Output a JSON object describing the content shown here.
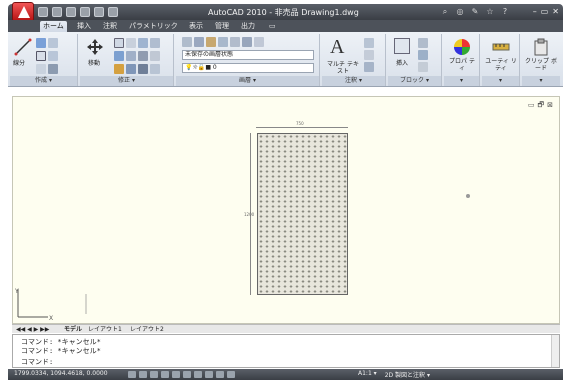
{
  "window": {
    "title": "AutoCAD 2010 - 非売品    Drawing1.dwg"
  },
  "ribbon": {
    "tabs": [
      "ホーム",
      "挿入",
      "注釈",
      "パラメトリック",
      "表示",
      "管理",
      "出力"
    ],
    "active_tab": "ホーム",
    "panels": {
      "draw": {
        "label": "作成 ▾",
        "line_label": "線分"
      },
      "modify": {
        "label": "修正 ▾",
        "move_label": "移動"
      },
      "layers": {
        "label": "画層 ▾",
        "layer_state": "未保存の画層状態",
        "current_layer": "0"
      },
      "annotation": {
        "label": "注釈 ▾",
        "mtext_label": "マルチ テキスト"
      },
      "block": {
        "label": "ブロック ▾",
        "insert_label": "挿入"
      },
      "properties": {
        "label": "▾",
        "name": "プロパ ティ"
      },
      "utilities": {
        "label": "▾",
        "name": "ユーティ リティ"
      },
      "clipboard": {
        "label": "▾",
        "name": "クリップ ボード"
      }
    }
  },
  "drawing": {
    "dim_top": "750",
    "dim_left": "1200",
    "doc_controls": [
      "▭",
      "🗗",
      "⊠"
    ]
  },
  "layout_tabs": [
    "モデル",
    "レイアウト1",
    "レイアウト2"
  ],
  "command_lines": [
    "コマンド: *キャンセル*",
    "コマンド: *キャンセル*",
    "コマンド:"
  ],
  "status": {
    "coords": "1799.0334, 1094.4618, 0.0000",
    "annotation_scale": "A1:1 ▾",
    "workspace": "2D 製図と注釈 ▾"
  },
  "colors": {
    "app_red": "#c62020",
    "canvas": "#fefef0"
  }
}
